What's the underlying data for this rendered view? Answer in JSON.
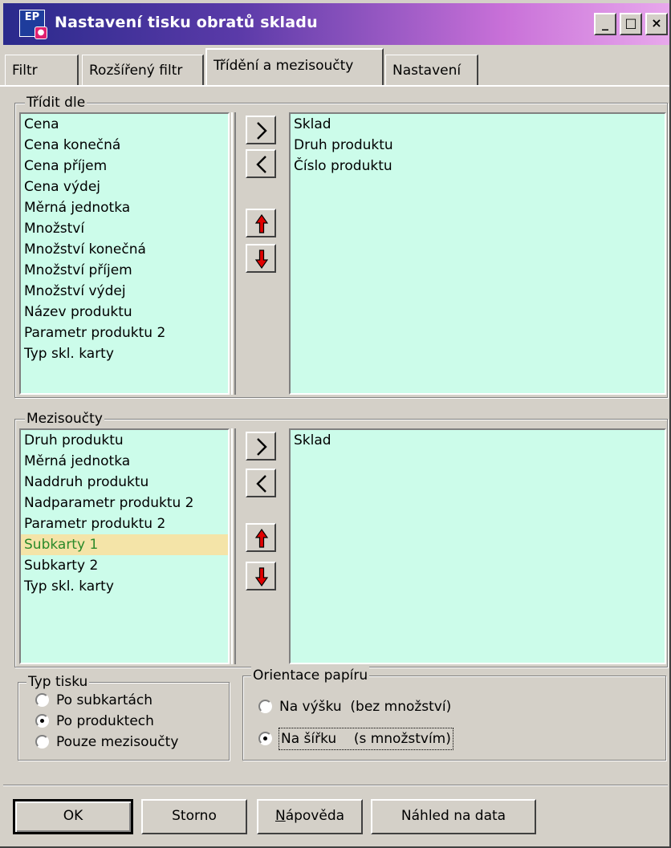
{
  "window": {
    "title": "Nastavení tisku obratů skladu",
    "icon_text": "EP",
    "min_label": "_",
    "max_label": "□",
    "close_label": "×"
  },
  "tabs": [
    {
      "label": "Filtr"
    },
    {
      "label": "Rozšířený filtr"
    },
    {
      "label": "Třídění a mezisoučty",
      "active": true
    },
    {
      "label": "Nastavení"
    }
  ],
  "sort": {
    "label": "Třídit dle",
    "available": [
      "Cena",
      "Cena konečná",
      "Cena příjem",
      "Cena výdej",
      "Měrná jednotka",
      "Množství",
      "Množství konečná",
      "Množství příjem",
      "Množství výdej",
      "Název produktu",
      "Parametr produktu 2",
      "Typ skl. karty"
    ],
    "selected": [
      "Sklad",
      "Druh produktu",
      "Číslo produktu"
    ],
    "add_label": "›",
    "remove_label": "‹"
  },
  "subtotals": {
    "label": "Mezisoučty",
    "available": [
      "Druh produktu",
      "Měrná jednotka",
      "Naddruh produktu",
      "Nadparametr produktu 2",
      "Parametr produktu 2",
      "Subkarty 1",
      "Subkarty 2",
      "Typ skl. karty"
    ],
    "highlighted": "Subkarty 1",
    "selected": [
      "Sklad"
    ],
    "add_label": "›",
    "remove_label": "‹"
  },
  "print_type": {
    "label": "Typ tisku",
    "options": [
      "Po subkartách",
      "Po produktech",
      "Pouze mezisoučty"
    ],
    "checked": "Po produktech"
  },
  "orientation": {
    "label": "Orientace papíru",
    "options": [
      "Na výšku  (bez množství)",
      "Na šířku    (s množstvím)"
    ],
    "checked": "Na šířku    (s množstvím)"
  },
  "buttons": {
    "ok": "OK",
    "cancel": "Storno",
    "help_first": "N",
    "help_rest": "ápověda",
    "preview": "Náhled na data"
  },
  "colors": {
    "list_bg": "#ccfcea",
    "highlight_bg": "#f4e4a8",
    "highlight_fg": "#2a8a2a",
    "arrow_red": "#e00000"
  }
}
